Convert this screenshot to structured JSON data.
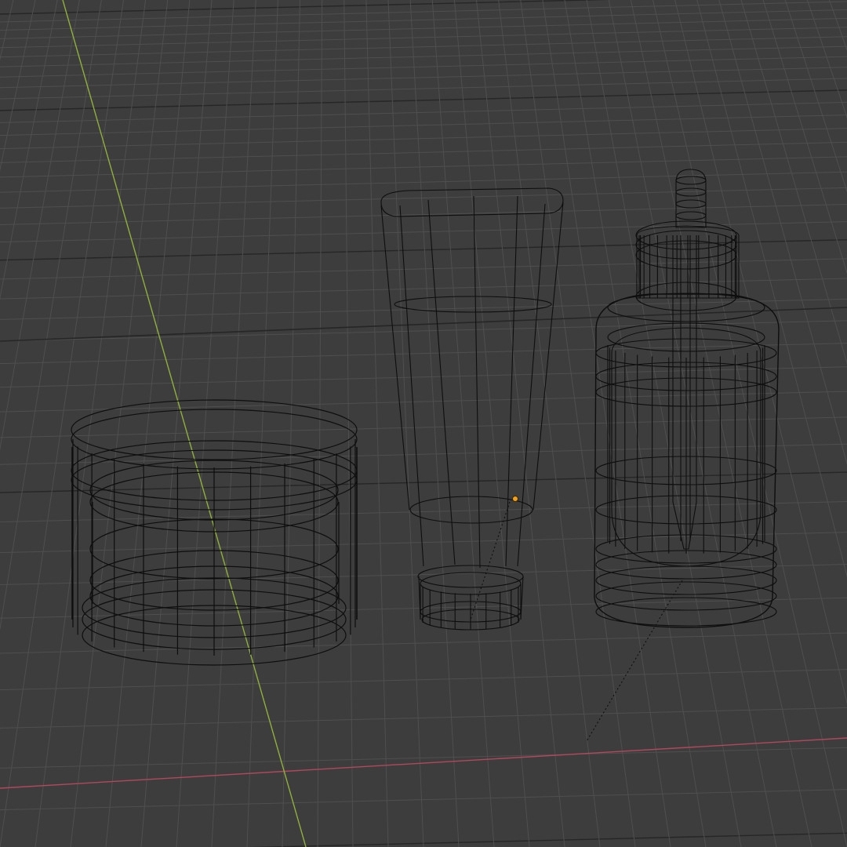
{
  "viewport": {
    "mode": "wireframe",
    "background_color": "#3d3d3d",
    "grid_color": "#4f4f4f",
    "grid_major_color": "#262626",
    "wire_color": "#0e0e0e",
    "x_axis_color": "#b0495c",
    "y_axis_color": "#8fb03c",
    "origin_color": "#f0a020"
  },
  "scene": {
    "objects": [
      {
        "name": "jar",
        "kind": "cylindrical-jar-with-lid"
      },
      {
        "name": "tube",
        "kind": "squeeze-tube"
      },
      {
        "name": "dropper-bottle",
        "kind": "bottle-with-dropper"
      }
    ],
    "selected_origin": "tube"
  }
}
